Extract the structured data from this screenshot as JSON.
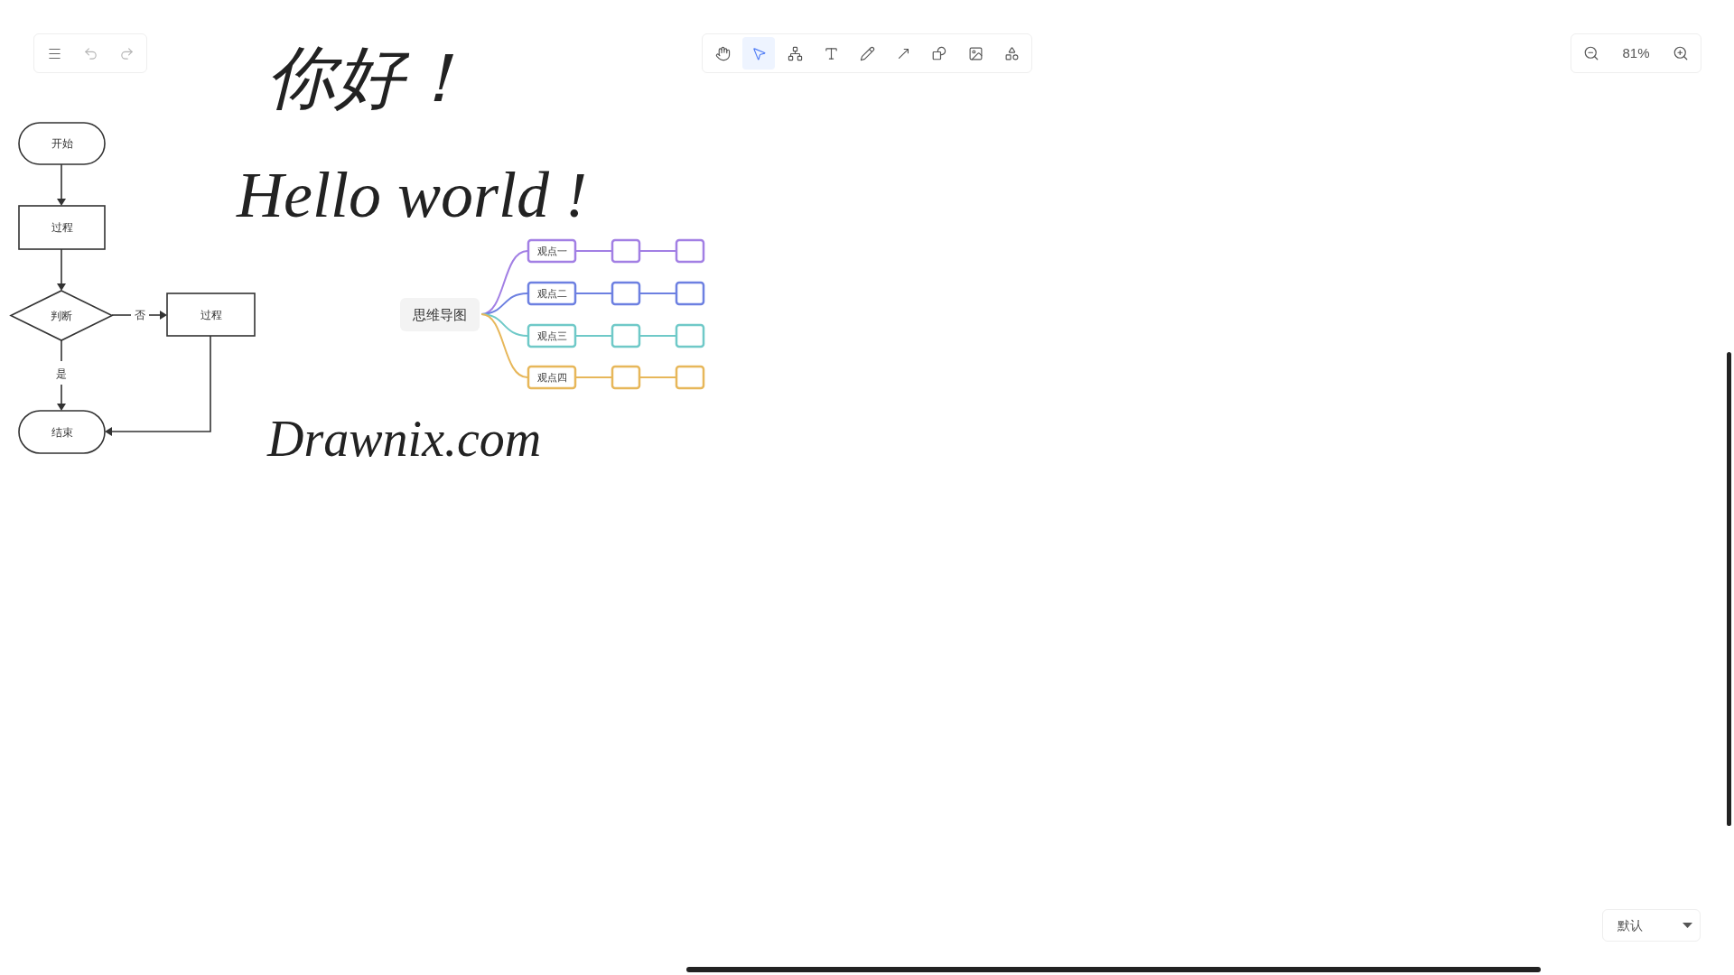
{
  "main_toolbar": {
    "tools": [
      {
        "kind": "menu"
      },
      {
        "kind": "undo",
        "disabled": true
      },
      {
        "kind": "redo",
        "disabled": true
      }
    ]
  },
  "creation_toolbar": {
    "tools": [
      {
        "kind": "hand",
        "selected": false
      },
      {
        "kind": "selection",
        "selected": true
      },
      {
        "kind": "mindmap",
        "selected": false
      },
      {
        "kind": "text",
        "selected": false
      },
      {
        "kind": "pen",
        "selected": false
      },
      {
        "kind": "arrow",
        "selected": false
      },
      {
        "kind": "shape",
        "selected": false
      },
      {
        "kind": "image",
        "selected": false
      },
      {
        "kind": "extra",
        "selected": false
      }
    ]
  },
  "zoom_toolbar": {
    "value": "81%"
  },
  "handwriting": [
    {
      "text": "你好！"
    },
    {
      "text": "Hello world !"
    },
    {
      "text": "Drawnix.com"
    }
  ],
  "flowchart": {
    "nodes": [
      {
        "kind": "terminal",
        "text": "开始"
      },
      {
        "kind": "process",
        "text": "过程"
      },
      {
        "kind": "decision",
        "text": "判断"
      },
      {
        "kind": "process",
        "text": "过程"
      },
      {
        "kind": "terminal",
        "text": "结束"
      }
    ],
    "edge_labels": [
      {
        "text": "否"
      },
      {
        "text": "是"
      }
    ]
  },
  "mindmap": {
    "root": "思维导图",
    "branches": [
      {
        "text": "观点一",
        "color": "#a27fe4"
      },
      {
        "text": "观点二",
        "color": "#6d80e1"
      },
      {
        "text": "观点三",
        "color": "#6fc9c8"
      },
      {
        "text": "观点四",
        "color": "#e7b75a"
      }
    ]
  },
  "theme_select": {
    "value": "默认"
  }
}
